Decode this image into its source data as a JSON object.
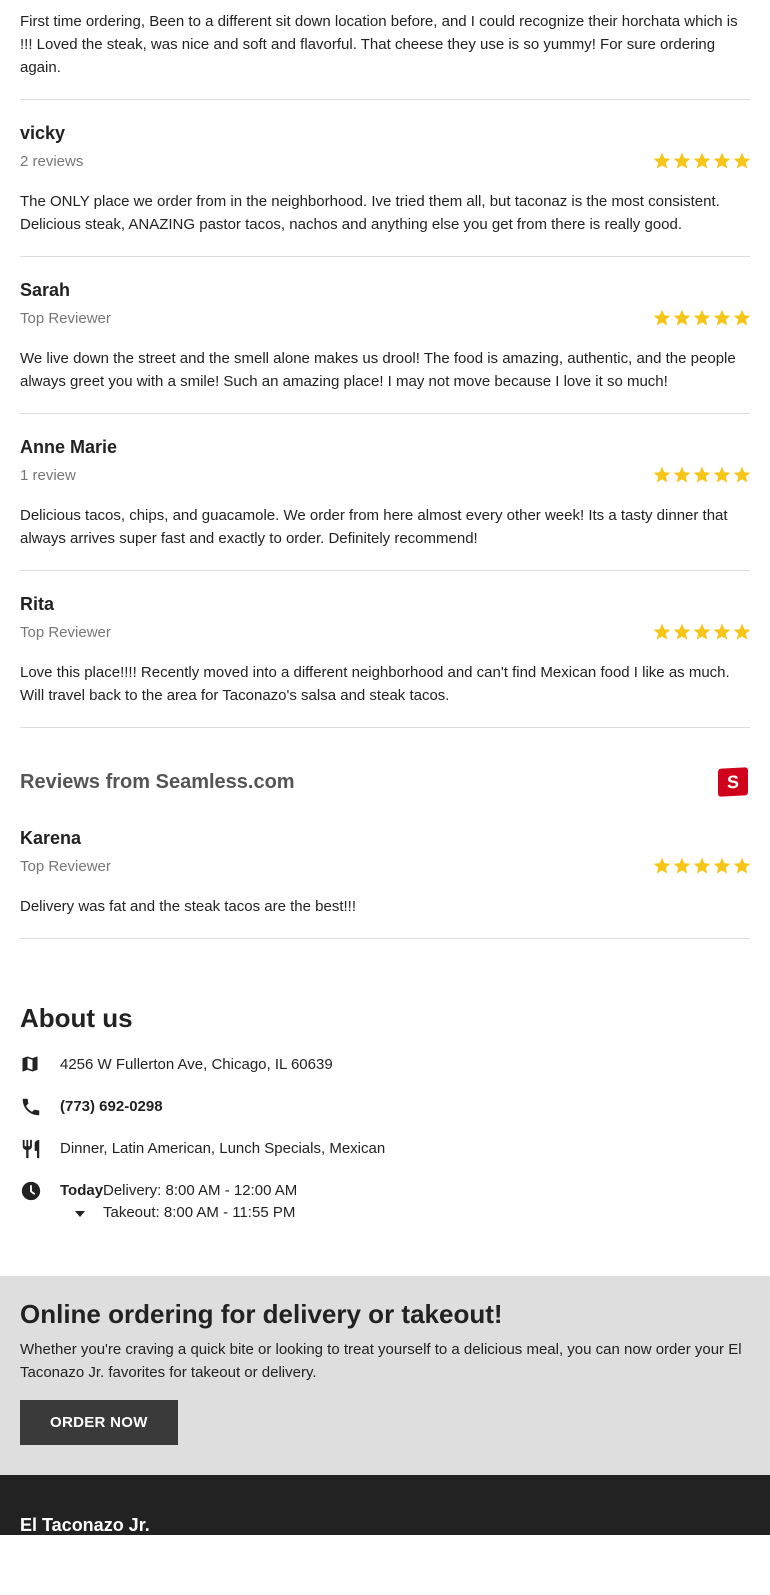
{
  "first_review": {
    "text": "First time ordering, Been to a different sit down location before, and I could recognize their horchata which is !!! Loved the steak, was nice and soft and flavorful. That cheese they use is so yummy! For sure ordering again."
  },
  "reviews": [
    {
      "name": "vicky",
      "sub": "2 reviews",
      "stars": 5,
      "text": "The ONLY place we order from in the neighborhood. Ive tried them all, but taconaz is the most consistent. Delicious steak, ANAZING pastor tacos, nachos and anything else you get from there is really good."
    },
    {
      "name": "Sarah",
      "sub": "Top Reviewer",
      "stars": 5,
      "text": "We live down the street and the smell alone makes us drool! The food is amazing, authentic, and the people always greet you with a smile! Such an amazing place! I may not move because I love it so much!"
    },
    {
      "name": "Anne Marie",
      "sub": "1 review",
      "stars": 5,
      "text": "Delicious tacos, chips, and guacamole. We order from here almost every other week! Its a tasty dinner that always arrives super fast and exactly to order. Definitely recommend!"
    },
    {
      "name": "Rita",
      "sub": "Top Reviewer",
      "stars": 5,
      "text": "Love this place!!!! Recently moved into a different neighborhood and can't find Mexican food I like as much. Will travel back to the area for Taconazo's salsa and steak tacos."
    }
  ],
  "seamless": {
    "title": "Reviews from Seamless.com",
    "logo_letter": "S",
    "logo_color": "#d0021b",
    "review": {
      "name": "Karena",
      "sub": "Top Reviewer",
      "stars": 5,
      "text": "Delivery was fat and the steak tacos are the best!!!"
    }
  },
  "star_color": "#f5c518",
  "about": {
    "title": "About us",
    "address": "4256 W Fullerton Ave, Chicago, IL 60639",
    "phone": "(773) 692-0298",
    "cuisines": "Dinner, Latin American, Lunch Specials, Mexican",
    "hours": {
      "today_label": "Today",
      "delivery": "Delivery: 8:00 AM - 12:00 AM",
      "takeout": "Takeout: 8:00 AM - 11:55 PM"
    },
    "icons": {
      "address": "map-icon",
      "phone": "phone-icon",
      "cuisines": "utensils-icon",
      "hours": "clock-icon"
    }
  },
  "banner": {
    "title": "Online ordering for delivery or takeout!",
    "text": "Whether you're craving a quick bite or looking to treat yourself to a delicious meal, you can now order your El Taconazo Jr. favorites for takeout or delivery.",
    "button_label": "ORDER NOW"
  },
  "footer": {
    "name": "El Taconazo Jr."
  }
}
